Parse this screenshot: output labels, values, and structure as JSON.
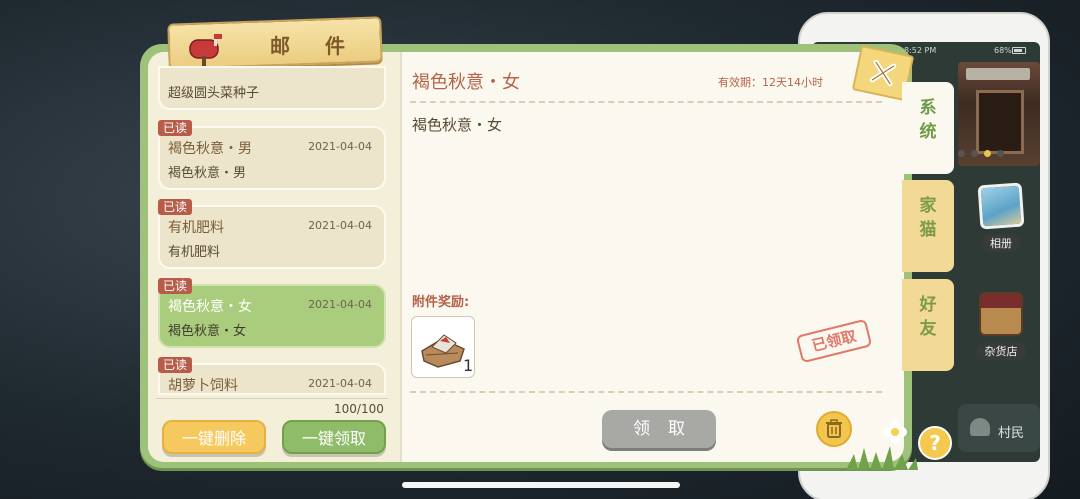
{
  "header": {
    "title": "邮 件"
  },
  "mail_list": [
    {
      "read_tag": "",
      "subject": "",
      "date": "",
      "body": "超级圆头菜种子",
      "selected": false
    },
    {
      "read_tag": "已读",
      "subject": "褐色秋意・男",
      "date": "2021-04-04",
      "body": "褐色秋意・男",
      "selected": false
    },
    {
      "read_tag": "已读",
      "subject": "有机肥料",
      "date": "2021-04-04",
      "body": "有机肥料",
      "selected": false
    },
    {
      "read_tag": "已读",
      "subject": "褐色秋意・女",
      "date": "2021-04-04",
      "body": "褐色秋意・女",
      "selected": true
    },
    {
      "read_tag": "已读",
      "subject": "胡萝卜饲料",
      "date": "2021-04-04",
      "body": "",
      "selected": false
    }
  ],
  "mail_count": "100/100",
  "buttons": {
    "delete_all": "一键删除",
    "claim_all": "一键领取",
    "claim": "领取"
  },
  "detail": {
    "title": "褐色秋意・女",
    "validity": "有效期：12天14小时",
    "body": "褐色秋意・女",
    "attachment_label": "附件奖励:",
    "attachment_count": "1",
    "claimed_stamp": "已领取"
  },
  "tabs": [
    {
      "label": "系统",
      "active": true
    },
    {
      "label": "家猫",
      "active": false
    },
    {
      "label": "好友",
      "active": false
    }
  ],
  "help": "?",
  "phone": {
    "time": "8:52 PM",
    "battery": "68%",
    "apps": [
      {
        "label": "相册",
        "icon": "photo-album-icon"
      },
      {
        "label": "杂货店",
        "icon": "shop-icon"
      }
    ],
    "villager_label": "村民"
  },
  "colors": {
    "panel_green": "#9fc27a",
    "selected_card": "#aacd7d",
    "accent_red": "#b6624a",
    "button_yellow": "#f5c95e",
    "button_green": "#8fbc68",
    "button_disabled": "#a8a8a4"
  }
}
